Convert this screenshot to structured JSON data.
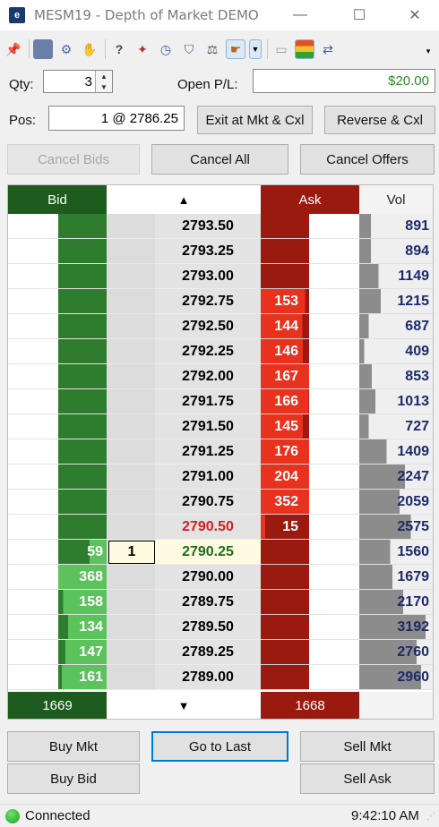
{
  "window": {
    "title": "MESM19 - Depth of Market DEMO",
    "icon_text": "e",
    "minimize": "—",
    "maximize": "☐",
    "close": "✕"
  },
  "form": {
    "qty_label": "Qty:",
    "qty_value": "3",
    "open_pl_label": "Open P/L:",
    "open_pl_value": "$20.00",
    "pos_label": "Pos:",
    "pos_value": "1 @ 2786.25",
    "exit_label": "Exit at Mkt & Cxl",
    "reverse_label": "Reverse & Cxl",
    "cancel_bids_label": "Cancel Bids",
    "cancel_all_label": "Cancel All",
    "cancel_offers_label": "Cancel Offers"
  },
  "ladder": {
    "header": {
      "bid": "Bid",
      "up_arrow": "▲",
      "ask": "Ask",
      "vol": "Vol",
      "down_arrow": "▼"
    },
    "bid_total": "1669",
    "ask_total": "1668",
    "colors": {
      "bid_dark": "#1e5b1e",
      "bid_green": "#2e7d2e",
      "bid_light": "#5cc25c",
      "ask_dark": "#9b1a10",
      "ask_red": "#e8321e",
      "last": "#fffbe0",
      "price_bg": "#e3e3e3",
      "vol_bar": "#8c8c8c"
    },
    "rows": [
      {
        "price": "2793.50",
        "bid": "",
        "ask": "",
        "vol": "891",
        "order": "",
        "style": "",
        "ask_fill": 0,
        "bid_fill": 0,
        "vol_fill": 0.16
      },
      {
        "price": "2793.25",
        "bid": "",
        "ask": "",
        "vol": "894",
        "order": "",
        "style": "",
        "ask_fill": 0,
        "bid_fill": 0,
        "vol_fill": 0.16
      },
      {
        "price": "2793.00",
        "bid": "",
        "ask": "",
        "vol": "1149",
        "order": "",
        "style": "",
        "ask_fill": 0,
        "bid_fill": 0,
        "vol_fill": 0.26
      },
      {
        "price": "2792.75",
        "bid": "",
        "ask": "153",
        "vol": "1215",
        "order": "",
        "style": "",
        "ask_fill": 0.92,
        "bid_fill": 0,
        "vol_fill": 0.29
      },
      {
        "price": "2792.50",
        "bid": "",
        "ask": "144",
        "vol": "687",
        "order": "",
        "style": "",
        "ask_fill": 0.86,
        "bid_fill": 0,
        "vol_fill": 0.13
      },
      {
        "price": "2792.25",
        "bid": "",
        "ask": "146",
        "vol": "409",
        "order": "",
        "style": "",
        "ask_fill": 0.87,
        "bid_fill": 0,
        "vol_fill": 0.07
      },
      {
        "price": "2792.00",
        "bid": "",
        "ask": "167",
        "vol": "853",
        "order": "",
        "style": "",
        "ask_fill": 1.0,
        "bid_fill": 0,
        "vol_fill": 0.17
      },
      {
        "price": "2791.75",
        "bid": "",
        "ask": "166",
        "vol": "1013",
        "order": "",
        "style": "",
        "ask_fill": 0.99,
        "bid_fill": 0,
        "vol_fill": 0.22
      },
      {
        "price": "2791.50",
        "bid": "",
        "ask": "145",
        "vol": "727",
        "order": "",
        "style": "",
        "ask_fill": 0.87,
        "bid_fill": 0,
        "vol_fill": 0.13
      },
      {
        "price": "2791.25",
        "bid": "",
        "ask": "176",
        "vol": "1409",
        "order": "",
        "style": "",
        "ask_fill": 1.0,
        "bid_fill": 0,
        "vol_fill": 0.37
      },
      {
        "price": "2791.00",
        "bid": "",
        "ask": "204",
        "vol": "2247",
        "order": "",
        "style": "",
        "ask_fill": 1.0,
        "bid_fill": 0,
        "vol_fill": 0.62
      },
      {
        "price": "2790.75",
        "bid": "",
        "ask": "352",
        "vol": "2059",
        "order": "",
        "style": "",
        "ask_fill": 1.0,
        "bid_fill": 0,
        "vol_fill": 0.55
      },
      {
        "price": "2790.50",
        "bid": "",
        "ask": "15",
        "vol": "2575",
        "order": "",
        "style": "ask-best",
        "ask_fill": 0.09,
        "bid_fill": 0,
        "vol_fill": 0.7
      },
      {
        "price": "2790.25",
        "bid": "59",
        "ask": "",
        "vol": "1560",
        "order": "1",
        "style": "last",
        "ask_fill": 0,
        "bid_fill": 0.35,
        "vol_fill": 0.42
      },
      {
        "price": "2790.00",
        "bid": "368",
        "ask": "",
        "vol": "1679",
        "order": "",
        "style": "",
        "ask_fill": 0,
        "bid_fill": 1.0,
        "vol_fill": 0.45
      },
      {
        "price": "2789.75",
        "bid": "158",
        "ask": "",
        "vol": "2170",
        "order": "",
        "style": "",
        "ask_fill": 0,
        "bid_fill": 0.9,
        "vol_fill": 0.6
      },
      {
        "price": "2789.50",
        "bid": "134",
        "ask": "",
        "vol": "3192",
        "order": "",
        "style": "",
        "ask_fill": 0,
        "bid_fill": 0.8,
        "vol_fill": 0.9
      },
      {
        "price": "2789.25",
        "bid": "147",
        "ask": "",
        "vol": "2760",
        "order": "",
        "style": "",
        "ask_fill": 0,
        "bid_fill": 0.85,
        "vol_fill": 0.78
      },
      {
        "price": "2789.00",
        "bid": "161",
        "ask": "",
        "vol": "2960",
        "order": "",
        "style": "",
        "ask_fill": 0,
        "bid_fill": 0.93,
        "vol_fill": 0.84
      }
    ]
  },
  "actions": {
    "buy_mkt": "Buy Mkt",
    "go_to_last": "Go to Last",
    "sell_mkt": "Sell Mkt",
    "buy_bid": "Buy Bid",
    "sell_ask": "Sell Ask"
  },
  "status": {
    "connection": "Connected",
    "time": "9:42:10 AM"
  },
  "toolbar_icons": [
    "pin-icon",
    "calculator-icon",
    "gear-icon",
    "hands-icon",
    "help-doc-icon",
    "run-icon",
    "clock-icon",
    "shield-icon",
    "sort-icon",
    "hand-pointer-icon",
    "dropdown-arrow-icon",
    "chart-icon",
    "color-grid-icon",
    "switch-icon"
  ]
}
